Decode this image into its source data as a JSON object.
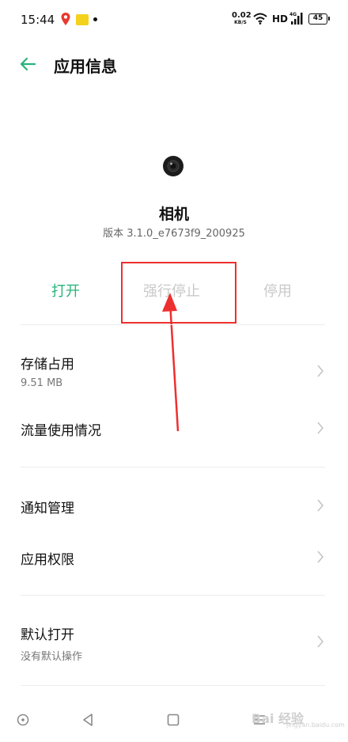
{
  "status_bar": {
    "time": "15:44",
    "net_speed": "0.02",
    "net_speed_unit": "KB/S",
    "hd": "HD",
    "signal_label": "4G",
    "battery": "45"
  },
  "header": {
    "title": "应用信息"
  },
  "app": {
    "name": "相机",
    "version": "版本 3.1.0_e7673f9_200925"
  },
  "actions": {
    "open": "打开",
    "force_stop": "强行停止",
    "disable": "停用"
  },
  "settings": {
    "storage": {
      "title": "存储占用",
      "subtitle": "9.51 MB"
    },
    "data_usage": {
      "title": "流量使用情况"
    },
    "notifications": {
      "title": "通知管理"
    },
    "permissions": {
      "title": "应用权限"
    },
    "default_open": {
      "title": "默认打开",
      "subtitle": "没有默认操作"
    }
  },
  "watermark": {
    "text": "Bai 经验",
    "sub": "jingyan.baidu.com"
  },
  "colors": {
    "accent": "#29b37a",
    "disabled": "#c9c9c9",
    "annotation": "#ee2f2f"
  }
}
